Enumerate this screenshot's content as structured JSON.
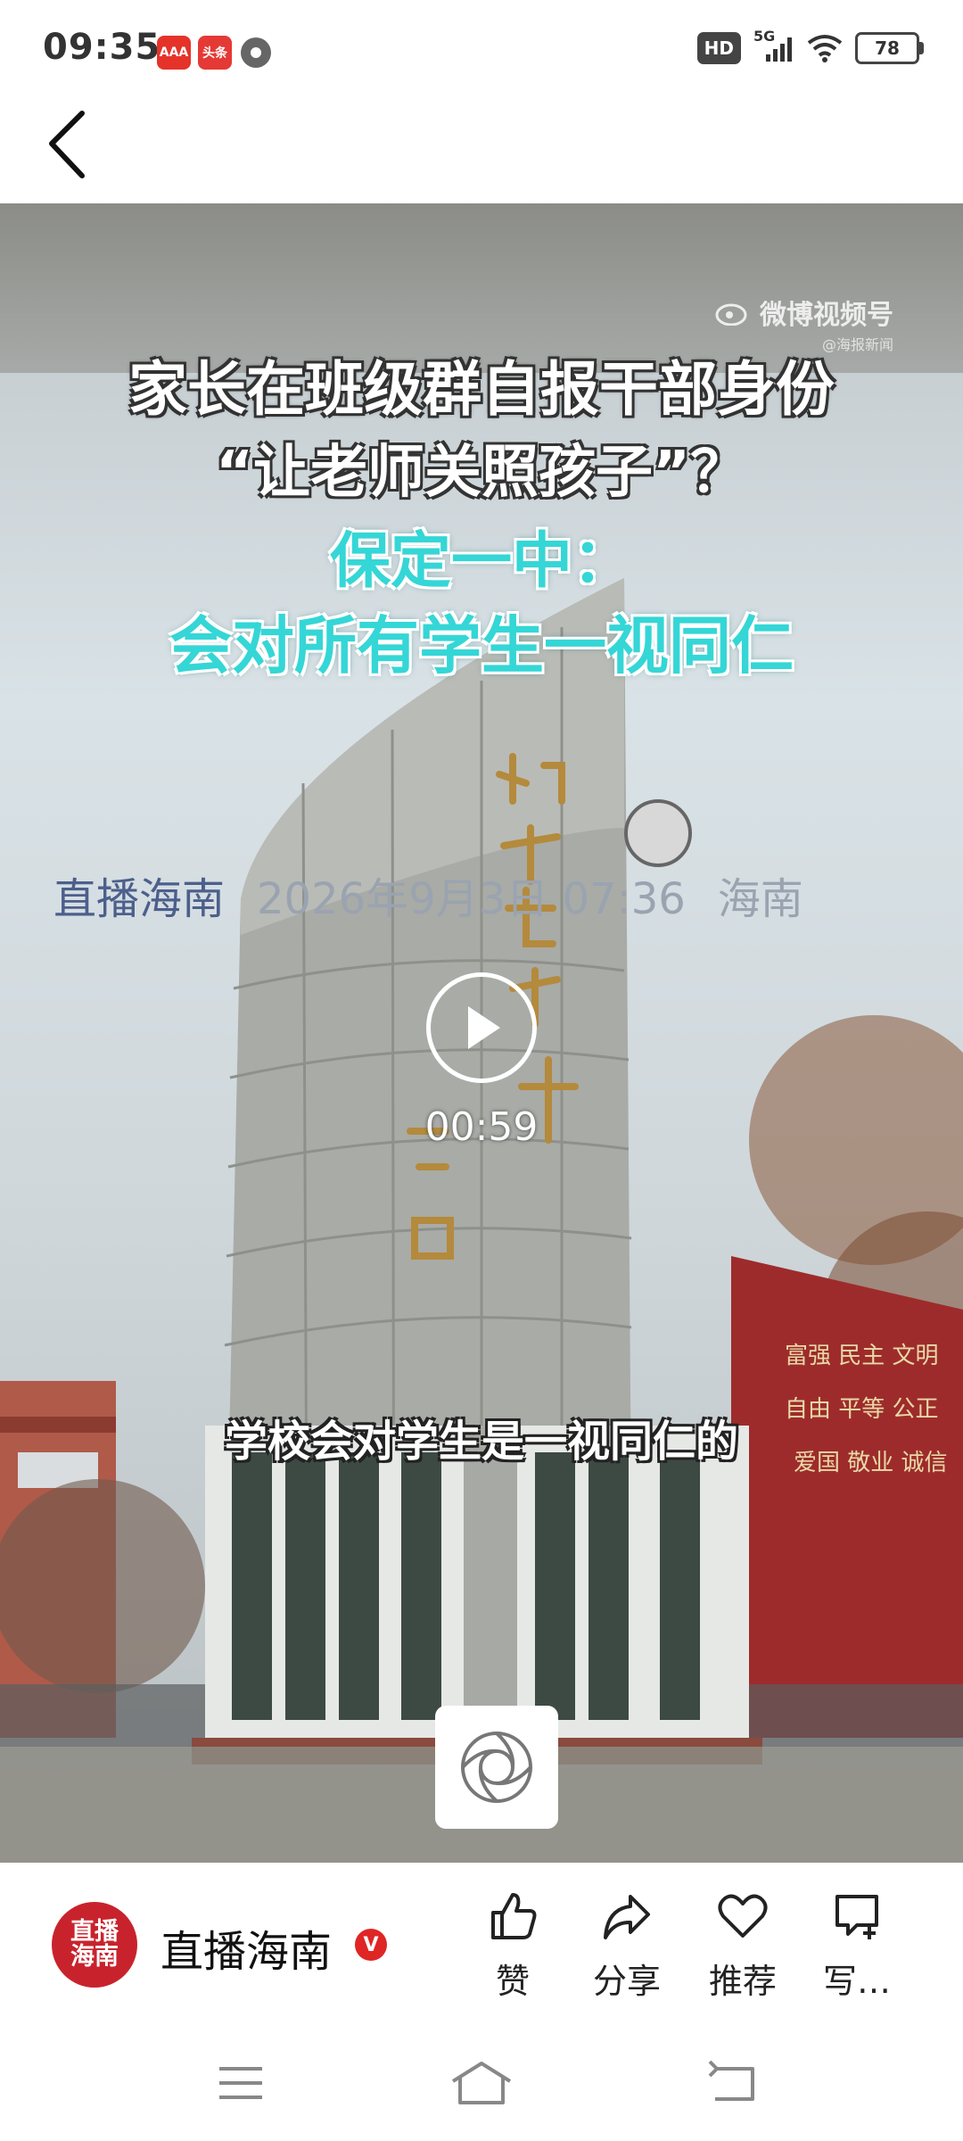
{
  "status_bar": {
    "time": "09:35",
    "badges": [
      "HD",
      "5G"
    ],
    "battery": "78",
    "app_badges": [
      {
        "text": "AAA",
        "color": "#e5332a"
      },
      {
        "text": "头条",
        "color": "#e53935"
      }
    ]
  },
  "video": {
    "watermark": "微博视频号",
    "watermark_sub": "@海报新闻",
    "headline": [
      "家长在班级群自报干部身份",
      "“让老师关照孩子”？",
      "保定一中：",
      "会对所有学生一视同仁"
    ],
    "overlay_meta": {
      "source": "直播海南",
      "date": "2026年9月3日 07:36",
      "location": "海南"
    },
    "duration": "00:59",
    "subtitle": "学校会对学生是一视同仁的"
  },
  "author": {
    "avatar_text": "直播\n海南",
    "name": "直播海南",
    "verified": "V"
  },
  "actions": [
    {
      "label": "赞",
      "icon": "thumbs-up-icon"
    },
    {
      "label": "分享",
      "icon": "share-icon"
    },
    {
      "label": "推荐",
      "icon": "heart-icon"
    },
    {
      "label": "写…",
      "icon": "comment-add-icon"
    }
  ],
  "colors": {
    "accent_red": "#c8232c",
    "headline_cyan": "#35d6d6",
    "meta_blue": "#4c5f8c"
  }
}
